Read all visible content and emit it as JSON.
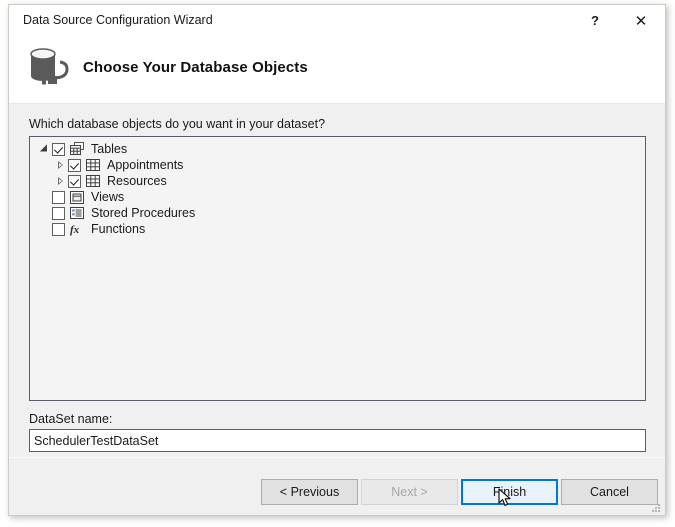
{
  "window": {
    "title": "Data Source Configuration Wizard",
    "help_label": "?",
    "close_label": "✕",
    "header_title": "Choose Your Database Objects",
    "header_icon": "database-connection-icon",
    "accent_color": "#0078d7",
    "panel_border_color": "#5a5e6b",
    "chrome_color": "#f0f0f0"
  },
  "body": {
    "prompt": "Which database objects do you want in your dataset?"
  },
  "tree": {
    "nodes": [
      {
        "label": "Tables",
        "icon": "tables-group-icon",
        "checked": true,
        "expanded": true,
        "has_children": true,
        "level": 0
      },
      {
        "label": "Appointments",
        "icon": "table-icon",
        "checked": true,
        "expanded": false,
        "has_children": true,
        "level": 1
      },
      {
        "label": "Resources",
        "icon": "table-icon",
        "checked": true,
        "expanded": false,
        "has_children": true,
        "level": 1
      },
      {
        "label": "Views",
        "icon": "view-icon",
        "checked": false,
        "expanded": false,
        "has_children": false,
        "level": 0
      },
      {
        "label": "Stored Procedures",
        "icon": "stored-procedure-icon",
        "checked": false,
        "expanded": false,
        "has_children": false,
        "level": 0
      },
      {
        "label": "Functions",
        "icon": "function-icon",
        "checked": false,
        "expanded": false,
        "has_children": false,
        "level": 0
      }
    ]
  },
  "dataset": {
    "label": "DataSet name:",
    "value": "SchedulerTestDataSet",
    "placeholder": ""
  },
  "footer": {
    "previous_label": "< Previous",
    "next_label": "Next >",
    "next_enabled": false,
    "finish_label": "Finish",
    "finish_focused": true,
    "cancel_label": "Cancel"
  }
}
